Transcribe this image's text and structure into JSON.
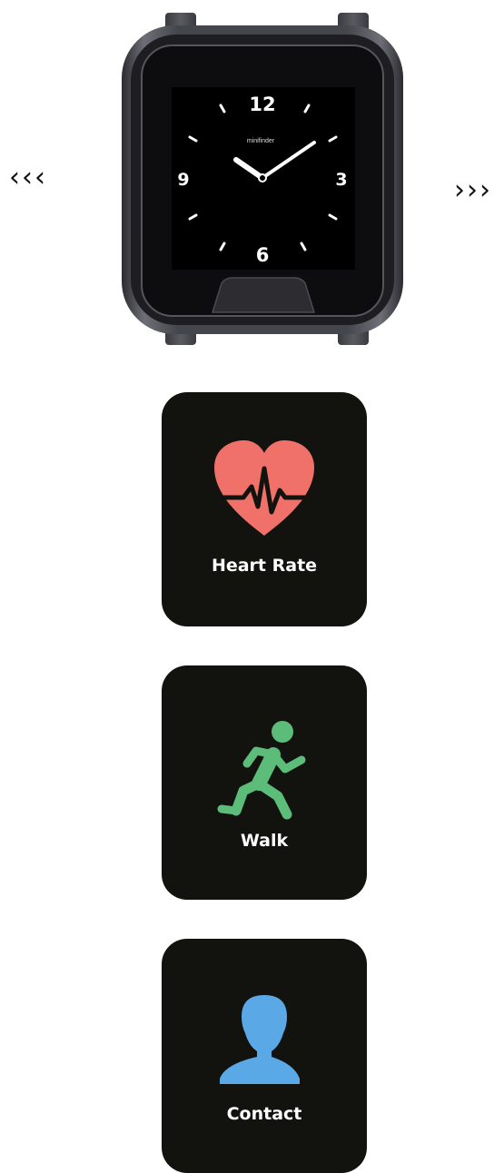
{
  "nav": {
    "prev_label": "‹‹‹",
    "next_label": "›››"
  },
  "watch": {
    "brand": "minifinder",
    "numerals": {
      "twelve": "12",
      "three": "3",
      "six": "6",
      "nine": "9"
    },
    "face_color": "#000000",
    "case_color": "#3a3a40"
  },
  "apps": [
    {
      "label": "Heart Rate",
      "icon": "heart-rate-icon",
      "color": "#f0706a"
    },
    {
      "label": "Walk",
      "icon": "running-person-icon",
      "color": "#5cbd7b"
    },
    {
      "label": "Contact",
      "icon": "person-silhouette-icon",
      "color": "#5aa8e6"
    }
  ]
}
